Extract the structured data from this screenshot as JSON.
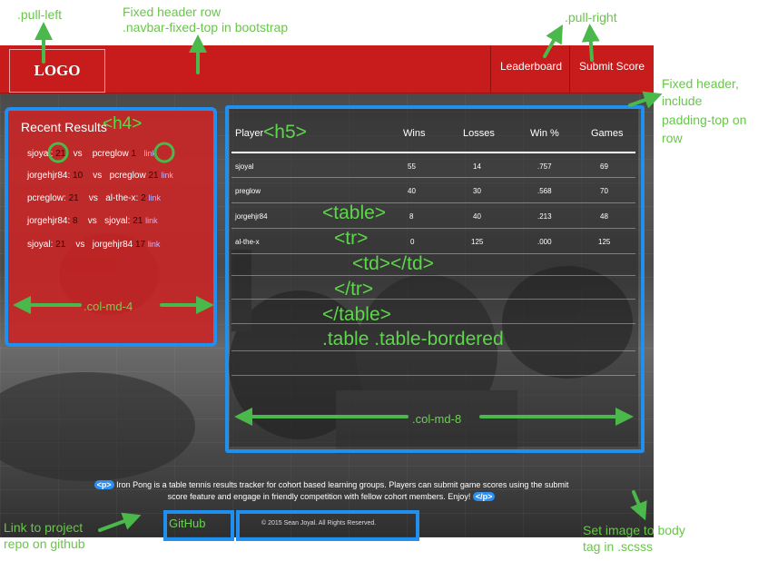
{
  "annotations": {
    "pull_left": ".pull-left",
    "fixed_header_row": "Fixed header row",
    "navbar_class": ".navbar-fixed-top in bootstrap",
    "pull_right": ".pull-right",
    "fixed_header_note": [
      "Fixed header,",
      "include",
      "padding-top on",
      "row"
    ],
    "h4": "<h4>",
    "h5": "<h5>",
    "table": "<table>",
    "tr": "<tr>",
    "td": "<td></td>",
    "tr_close": "</tr>",
    "table_close": "</table>",
    "table_classes": ".table .table-bordered",
    "col_md_4": ".col-md-4",
    "col_md_8": ".col-md-8",
    "p_open": "<p>",
    "p_close": "</p>",
    "repo_link": [
      "Link to project",
      "repo on github"
    ],
    "body_image": [
      "Set image to body",
      "tag in .scsss"
    ]
  },
  "navbar": {
    "logo": "LOGO",
    "links": [
      "Leaderboard",
      "Submit Score"
    ],
    "color": "#c81b1b"
  },
  "recent_results": {
    "title": "Recent Results",
    "items": [
      {
        "p1": "sjoyal:",
        "s1": "21",
        "vs": "vs",
        "p2": "pcreglow",
        "s2": "1",
        "link": "link"
      },
      {
        "p1": "jorgehjr84:",
        "s1": "10",
        "vs": "vs",
        "p2": "pcreglow",
        "s2": "21",
        "link": "link"
      },
      {
        "p1": "pcreglow:",
        "s1": "21",
        "vs": "vs",
        "p2": "al-the-x:",
        "s2": "2",
        "link": "link"
      },
      {
        "p1": "jorgehjr84:",
        "s1": "8",
        "vs": "vs",
        "p2": "sjoyal:",
        "s2": "21",
        "link": "link"
      },
      {
        "p1": "sjoyal:",
        "s1": "21",
        "vs": "vs",
        "p2": "jorgehjr84",
        "s2": "17",
        "link": "link"
      }
    ]
  },
  "leaderboard": {
    "headers": [
      "Player",
      "Wins",
      "Losses",
      "Win %",
      "Games"
    ],
    "rows": [
      [
        "sjoyal",
        "55",
        "14",
        ".757",
        "69"
      ],
      [
        "preglow",
        "40",
        "30",
        ".568",
        "70"
      ],
      [
        "jorgehjr84",
        "8",
        "40",
        ".213",
        "48"
      ],
      [
        "al-the-x",
        "0",
        "125",
        ".000",
        "125"
      ]
    ]
  },
  "footer": {
    "text_line1": "Iron Pong is a table tennis results tracker for cohort based learning groups. Players can submit game scores using the submit",
    "text_line2": "score feature and engage in friendly competition with fellow cohort members. Enjoy!",
    "github": "GitHub",
    "copyright": "© 2015 Sean Joyal. All Rights Reserved."
  },
  "colors": {
    "frame_blue": "#1f8ff0",
    "annotation_green": "#69c64a",
    "panel_red": "#cd2323"
  }
}
